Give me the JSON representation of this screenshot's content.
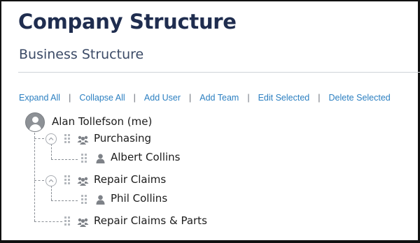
{
  "page": {
    "title": "Company Structure",
    "section_title": "Business Structure"
  },
  "toolbar": {
    "expand_all": "Expand All",
    "collapse_all": "Collapse All",
    "add_user": "Add User",
    "add_team": "Add Team",
    "edit_selected": "Edit Selected",
    "delete_selected": "Delete Selected",
    "separator": "|"
  },
  "tree": {
    "root": {
      "label": "Alan Tollefson (me)",
      "icon": "user-avatar-icon"
    },
    "teams": [
      {
        "label": "Purchasing",
        "icon": "team-icon",
        "expanded": true,
        "members": [
          {
            "label": "Albert Collins",
            "icon": "user-icon"
          }
        ]
      },
      {
        "label": "Repair Claims",
        "icon": "team-icon",
        "expanded": true,
        "members": [
          {
            "label": "Phil Collins",
            "icon": "user-icon"
          }
        ]
      },
      {
        "label": "Repair Claims & Parts",
        "icon": "team-icon",
        "expanded": false,
        "members": []
      }
    ]
  },
  "colors": {
    "title": "#1f2d4f",
    "link": "#2b7fc1",
    "icon_gray": "#8d9196",
    "connector": "#8a8f96"
  }
}
